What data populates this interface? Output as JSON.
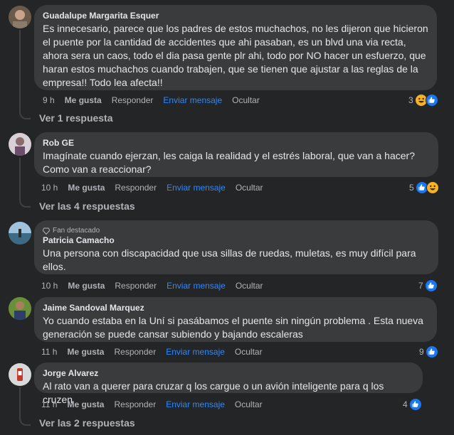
{
  "colors": {
    "background": "#242526",
    "bubble": "#3a3b3c",
    "text": "#e4e6eb",
    "muted": "#b0b3b8",
    "link_blue": "#2d88ff",
    "like_blue": "#1877f2",
    "haha_yellow": "#f7b125"
  },
  "comments": [
    {
      "author": "Guadalupe Margarita Esquer",
      "text": "Es innecesario, parece que los padres de estos muchachos, no les dijeron que hicieron el puente por la cantidad de accidentes que ahi pasaban, es un blvd una via recta, ahora sera un caos, todo el dia pasa gente plr ahi, todo por NO hacer un esfuerzo, que haran estos muchachos cuando trabajen, que se tienen que ajustar a las reglas de la empresa!! Todo lea afecta!!",
      "time": "9 h",
      "like": "Me gusta",
      "reply": "Responder",
      "send": "Enviar mensaje",
      "hide": "Ocultar",
      "reaction_count": "3",
      "reaction_icons": [
        "haha-icon",
        "like-icon"
      ],
      "replies_link": "Ver 1 respuesta"
    },
    {
      "author": "Rob GE",
      "text": "Imagínate cuando ejerzan, les caiga la realidad y el estrés laboral, que van a hacer? Como van a reaccionar?",
      "time": "10 h",
      "like": "Me gusta",
      "reply": "Responder",
      "send": "Enviar mensaje",
      "hide": "Ocultar",
      "reaction_count": "5",
      "reaction_icons": [
        "like-icon",
        "haha-icon"
      ],
      "replies_link": "Ver las 4 respuestas"
    },
    {
      "badge": "Fan destacado",
      "author": "Patricia Camacho",
      "text": "Una persona con discapacidad que usa sillas de ruedas, muletas, es muy difícil para ellos.",
      "time": "10 h",
      "like": "Me gusta",
      "reply": "Responder",
      "send": "Enviar mensaje",
      "hide": "Ocultar",
      "reaction_count": "7",
      "reaction_icons": [
        "like-icon"
      ]
    },
    {
      "author": "Jaime Sandoval Marquez",
      "text": "Yo cuando estaba en la Uní si pasábamos el puente sin ningún problema . Esta nueva generación se puede cansar subiendo y bajando escaleras",
      "time": "11 h",
      "like": "Me gusta",
      "reply": "Responder",
      "send": "Enviar mensaje",
      "hide": "Ocultar",
      "reaction_count": "9",
      "reaction_icons": [
        "like-icon"
      ]
    },
    {
      "author": "Jorge Alvarez",
      "text": "Al rato van a querer para cruzar q los cargue o un avión inteligente para q los cruzen",
      "time": "11 h",
      "like": "Me gusta",
      "reply": "Responder",
      "send": "Enviar mensaje",
      "hide": "Ocultar",
      "reaction_count": "4",
      "reaction_icons": [
        "like-icon"
      ],
      "replies_link": "Ver las 2 respuestas"
    }
  ]
}
